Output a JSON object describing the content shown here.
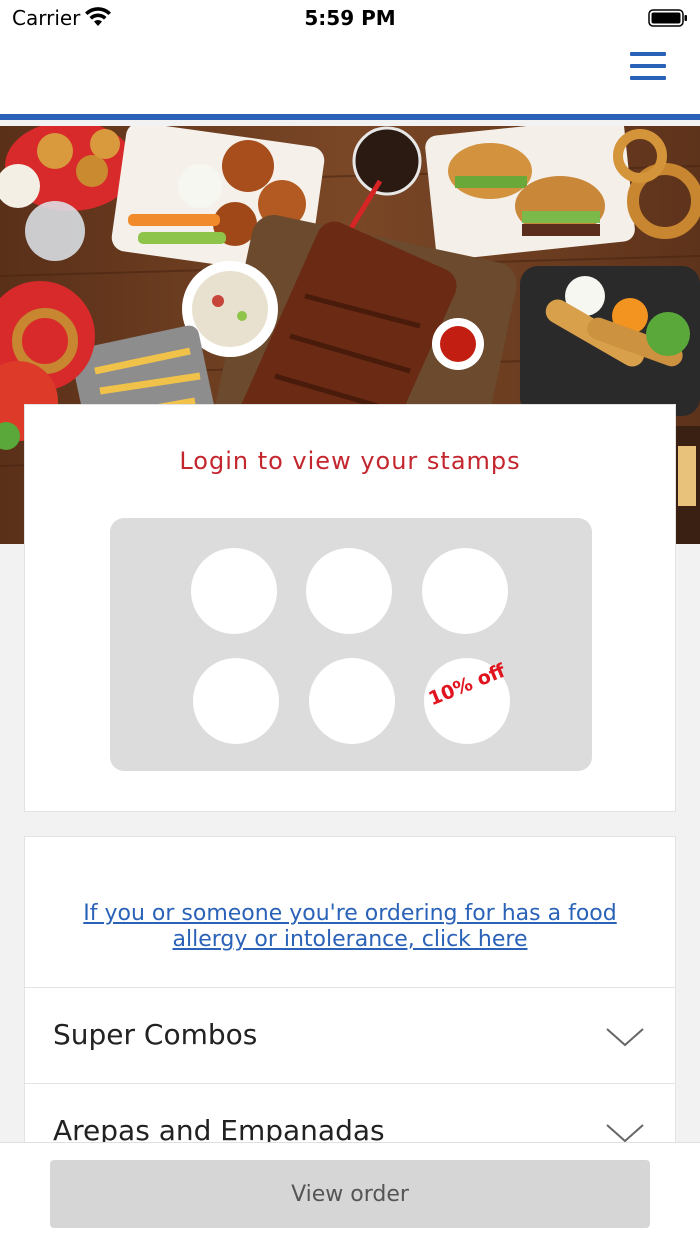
{
  "status_bar": {
    "carrier": "Carrier",
    "time": "5:59 PM",
    "icons": [
      "wifi-icon",
      "battery-icon"
    ]
  },
  "nav": {
    "menu_icon": "hamburger-menu-icon",
    "accent_color": "#2a62b8"
  },
  "hero": {
    "image": "food-spread-illustration"
  },
  "stamps": {
    "title": "Login to view your stamps",
    "title_color": "#c4262e",
    "total_stamps": 6,
    "collected_stamps": 0,
    "reward_text": "10% off",
    "reward_color": "#e0141e"
  },
  "menu": {
    "allergy_link": "If you or someone you're ordering for has a food allergy or intolerance, click here",
    "link_color": "#2a62b8",
    "categories": [
      {
        "label": "Super Combos",
        "icon": "chevron-down-icon"
      },
      {
        "label": "Arepas and Empanadas",
        "icon": "chevron-down-icon"
      }
    ]
  },
  "footer": {
    "view_order_label": "View order"
  }
}
